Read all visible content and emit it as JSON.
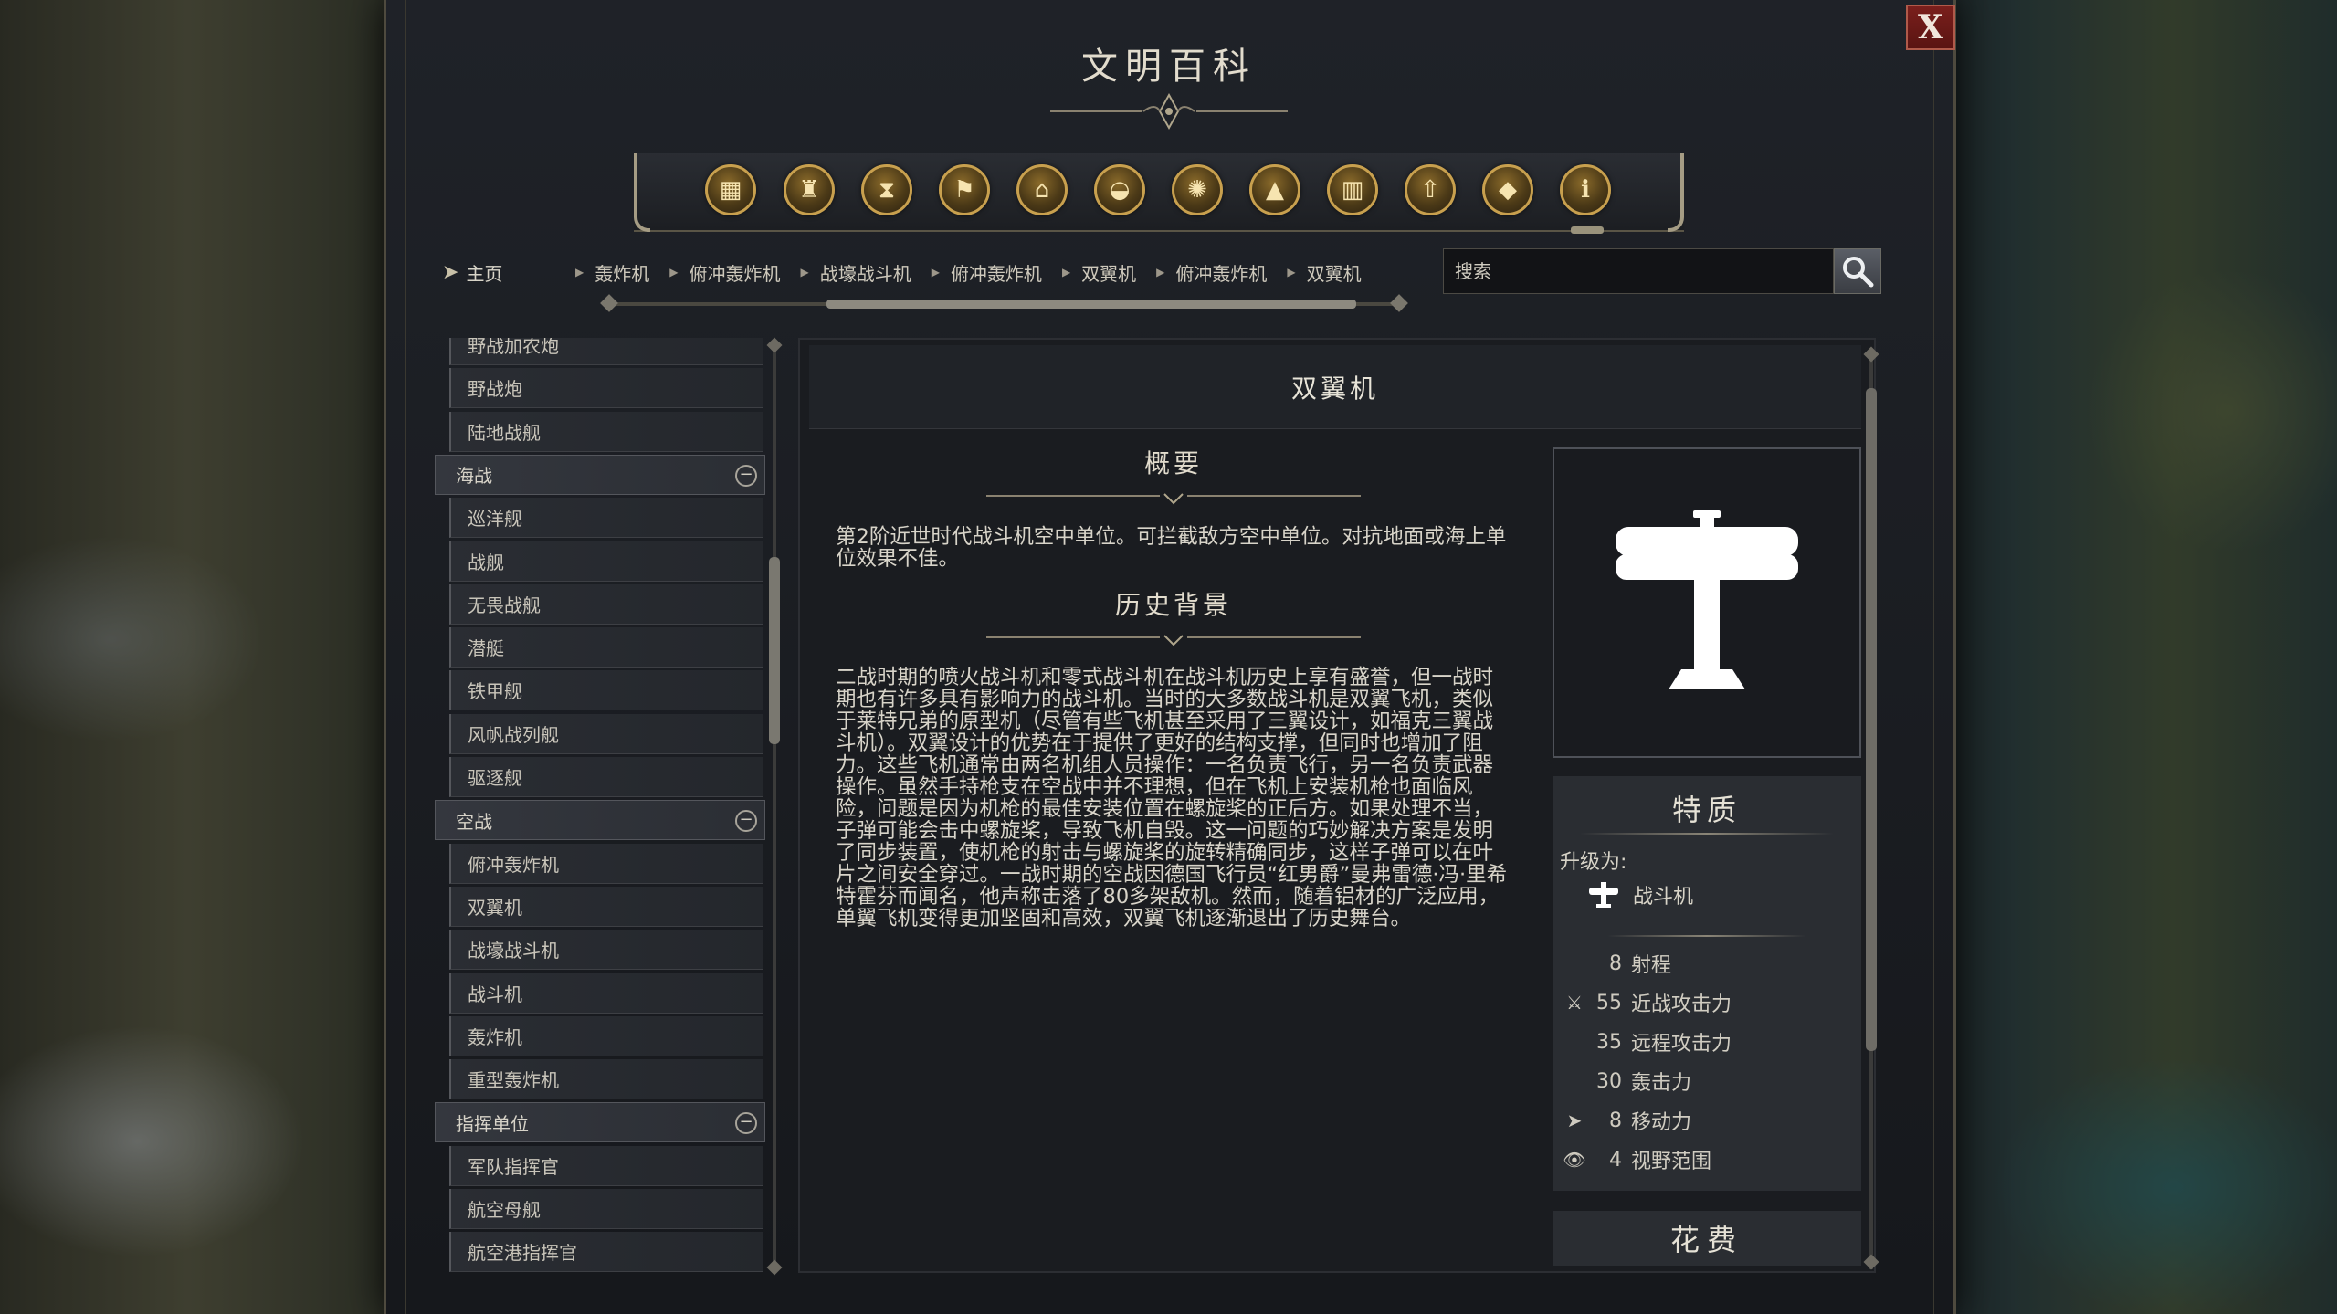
{
  "window": {
    "title": "文明百科",
    "close_label": "X"
  },
  "icon_bar": {
    "icons": [
      {
        "name": "units-icon",
        "glyph": "▦"
      },
      {
        "name": "buildings-icon",
        "glyph": "♜"
      },
      {
        "name": "eras-icon",
        "glyph": "⧗"
      },
      {
        "name": "flag-icon",
        "glyph": "⚑"
      },
      {
        "name": "civics-icon",
        "glyph": "⌂"
      },
      {
        "name": "wonders-icon",
        "glyph": "◒"
      },
      {
        "name": "science-icon",
        "glyph": "✺"
      },
      {
        "name": "terrain-icon",
        "glyph": "▲"
      },
      {
        "name": "improvements-icon",
        "glyph": "▥"
      },
      {
        "name": "upgrade-icon",
        "glyph": "⇧"
      },
      {
        "name": "resources-icon",
        "glyph": "◆"
      },
      {
        "name": "info-icon",
        "glyph": "ℹ"
      }
    ]
  },
  "nav": {
    "home_label": "主页",
    "breadcrumbs": [
      "轰炸机",
      "俯冲轰炸机",
      "战壕战斗机",
      "俯冲轰炸机",
      "双翼机",
      "俯冲轰炸机",
      "双翼机"
    ]
  },
  "search": {
    "placeholder": "搜索"
  },
  "list": {
    "items_top": [
      "野战加农炮",
      "野战炮",
      "陆地战舰"
    ],
    "cat_naval": "海战",
    "items_naval": [
      "巡洋舰",
      "战舰",
      "无畏战舰",
      "潜艇",
      "铁甲舰",
      "风帆战列舰",
      "驱逐舰"
    ],
    "cat_air": "空战",
    "items_air": [
      "俯冲轰炸机",
      "双翼机",
      "战壕战斗机",
      "战斗机",
      "轰炸机",
      "重型轰炸机"
    ],
    "cat_command": "指挥单位",
    "items_command": [
      "军队指挥官",
      "航空母舰",
      "航空港指挥官"
    ]
  },
  "content": {
    "title": "双翼机",
    "overview_title": "概要",
    "overview_text": "第2阶近世时代战斗机空中单位。可拦截敌方空中单位。对抗地面或海上单位效果不佳。",
    "history_title": "历史背景",
    "history_text": "二战时期的喷火战斗机和零式战斗机在战斗机历史上享有盛誉，但一战时期也有许多具有影响力的战斗机。当时的大多数战斗机是双翼飞机，类似于莱特兄弟的原型机（尽管有些飞机甚至采用了三翼设计，如福克三翼战斗机）。双翼设计的优势在于提供了更好的结构支撑，但同时也增加了阻力。这些飞机通常由两名机组人员操作：一名负责飞行，另一名负责武器操作。虽然手持枪支在空战中并不理想，但在飞机上安装机枪也面临风险，问题是因为机枪的最佳安装位置在螺旋桨的正后方。如果处理不当，子弹可能会击中螺旋桨，导致飞机自毁。这一问题的巧妙解决方案是发明了同步装置，使机枪的射击与螺旋桨的旋转精确同步，这样子弹可以在叶片之间安全穿过。一战时期的空战因德国飞行员“红男爵”曼弗雷德·冯·里希特霍芬而闻名，他声称击落了80多架敌机。然而，随着铝材的广泛应用，单翼飞机变得更加坚固和高效，双翼飞机逐渐退出了历史舞台。"
  },
  "traits": {
    "title": "特质",
    "upgrade_label": "升级为:",
    "upgrade_target": "战斗机",
    "stats": [
      {
        "value": "8",
        "label": "射程",
        "icon": "",
        "icon_name": "range-icon"
      },
      {
        "value": "55",
        "label": "近战攻击力",
        "icon": "⚔",
        "icon_name": "melee-attack-icon"
      },
      {
        "value": "35",
        "label": "远程攻击力",
        "icon": "",
        "icon_name": "ranged-attack-icon"
      },
      {
        "value": "30",
        "label": "轰击力",
        "icon": "",
        "icon_name": "bombard-icon"
      },
      {
        "value": "8",
        "label": "移动力",
        "icon": "➤",
        "icon_name": "movement-icon"
      },
      {
        "value": "4",
        "label": "视野范围",
        "icon": "👁",
        "icon_name": "sight-icon"
      }
    ]
  },
  "cost": {
    "title": "花费"
  },
  "colors": {
    "accent_gold": "#c8a04e",
    "close_red": "#7a1f1c",
    "panel_bg": "#1a1c20"
  }
}
